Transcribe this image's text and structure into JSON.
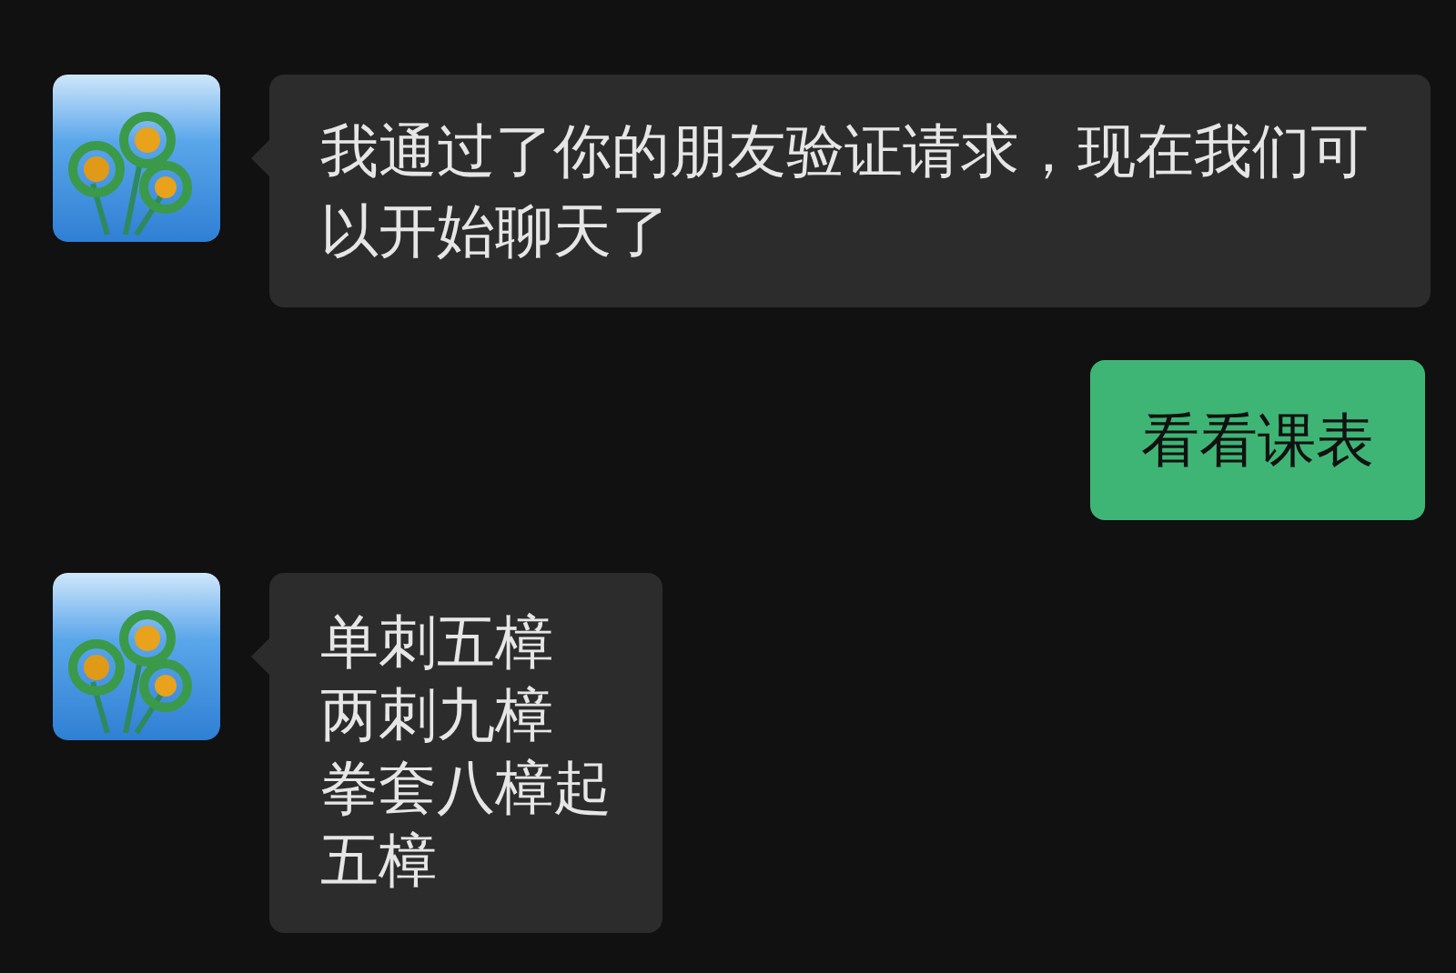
{
  "messages": [
    {
      "kind": "received",
      "lines": [
        "我通过了你的朋友验证请求，现在我们可以开始聊天了"
      ]
    },
    {
      "kind": "sent",
      "lines": [
        "看看课表"
      ]
    },
    {
      "kind": "received",
      "lines": [
        "单刺五樟",
        "两刺九樟",
        "拳套八樟起",
        "五樟"
      ]
    }
  ]
}
